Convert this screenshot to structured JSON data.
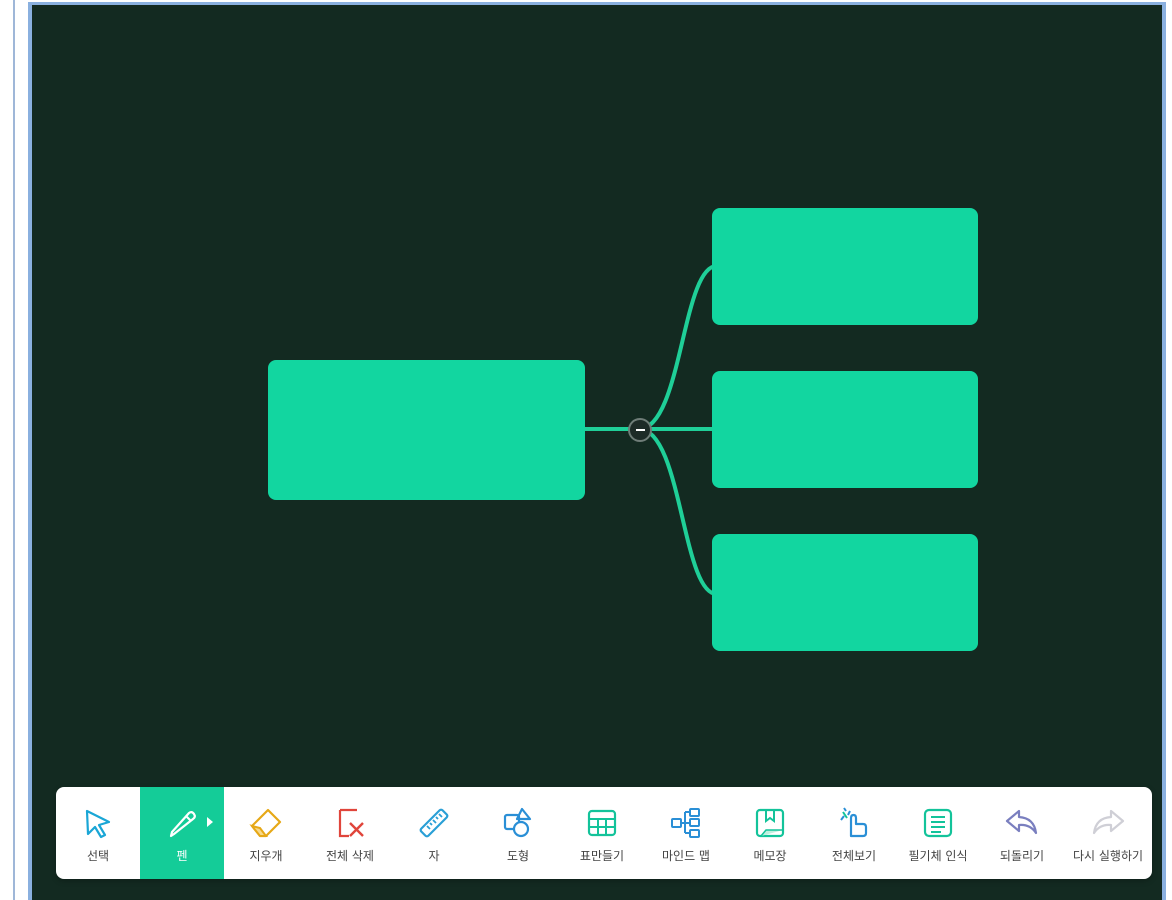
{
  "toolbar": {
    "tools": [
      {
        "label": "선택",
        "icon": "cursor-icon",
        "color": "#1aa6d6"
      },
      {
        "label": "펜",
        "icon": "pen-icon",
        "color": "#ffffff",
        "active": true
      },
      {
        "label": "지우개",
        "icon": "eraser-icon",
        "color": "#e6a817"
      },
      {
        "label": "전체 삭제",
        "icon": "clear-all-icon",
        "color": "#e0453b"
      },
      {
        "label": "자",
        "icon": "ruler-icon",
        "color": "#2a9fd6"
      },
      {
        "label": "도형",
        "icon": "shape-icon",
        "color": "#2a8fd6"
      },
      {
        "label": "표만들기",
        "icon": "table-icon",
        "color": "#13c39a"
      },
      {
        "label": "마인드 맵",
        "icon": "mind-map-icon",
        "color": "#2a8fd6"
      },
      {
        "label": "메모장",
        "icon": "memo-icon",
        "color": "#13c39a"
      },
      {
        "label": "전체보기",
        "icon": "fullview-hand-icon",
        "color": "#2a8fd6"
      },
      {
        "label": "필기체 인식",
        "icon": "handwriting-icon",
        "color": "#13c39a"
      },
      {
        "label": "되돌리기",
        "icon": "undo-icon",
        "color": "#7a7fbf"
      },
      {
        "label": "다시 실행하기",
        "icon": "redo-icon",
        "color": "#cfcfd6"
      }
    ]
  },
  "colors": {
    "canvas_bg": "#132a21",
    "node_fill": "#12d6a0",
    "connector": "#1fcf98",
    "active_tool": "#14cc98"
  }
}
